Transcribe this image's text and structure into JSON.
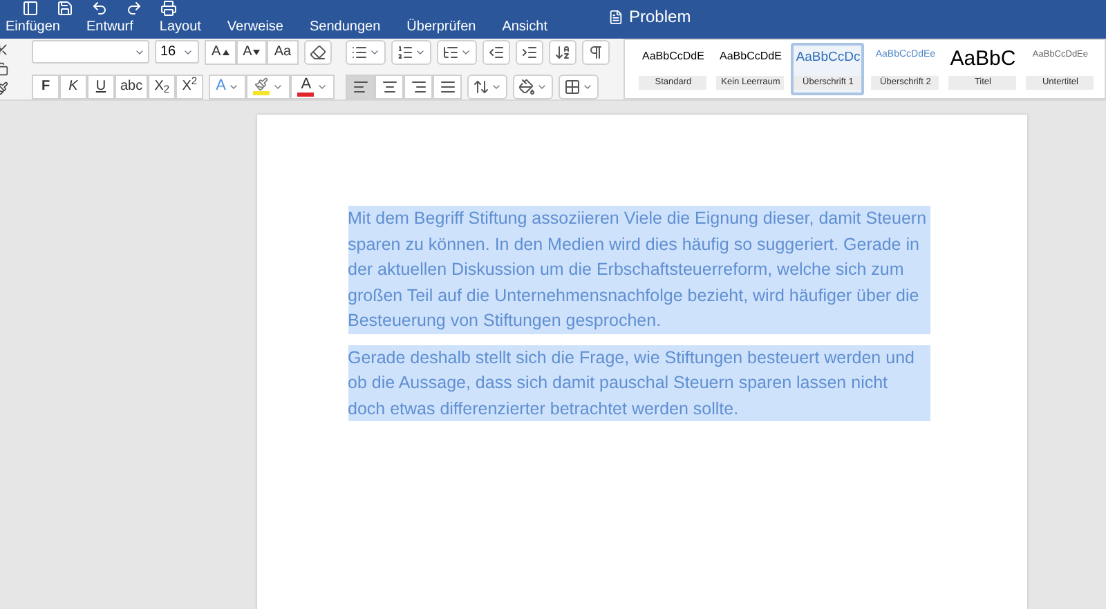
{
  "window": {
    "title": "Problem"
  },
  "tabs": [
    {
      "label": "Einfügen",
      "selected": false
    },
    {
      "label": "Entwurf",
      "selected": false
    },
    {
      "label": "Layout",
      "selected": false
    },
    {
      "label": "Verweise",
      "selected": false
    },
    {
      "label": "Sendungen",
      "selected": false
    },
    {
      "label": "Überprüfen",
      "selected": false
    },
    {
      "label": "Ansicht",
      "selected": false
    }
  ],
  "font": {
    "size": "16"
  },
  "format_buttons": [
    {
      "label": "F",
      "kind": "bold"
    },
    {
      "label": "K",
      "kind": "italic"
    },
    {
      "label": "U",
      "kind": "underline"
    },
    {
      "label": "abc",
      "kind": "strike"
    },
    {
      "label": "X$_{2}$",
      "kind": "script"
    },
    {
      "label": "X$^{2}$",
      "kind": "script"
    }
  ],
  "size_buttons": [
    {
      "label": "A",
      "kind": "grow"
    },
    {
      "label": "A",
      "kind": "shrink"
    },
    {
      "label": "Aa",
      "kind": "case"
    }
  ],
  "color_buttons": [
    {
      "label": "A",
      "kind": "effect",
      "color": "#4a90e2"
    },
    {
      "kind": "highlight",
      "color": "#f5e42a"
    },
    {
      "label": "A",
      "kind": "font",
      "color": "#e0262b"
    }
  ],
  "alignment": [
    {
      "kind": "left",
      "selected": true
    },
    {
      "kind": "center",
      "selected": false
    },
    {
      "kind": "right",
      "selected": false
    },
    {
      "kind": "justify",
      "selected": false
    }
  ],
  "styles": [
    {
      "preview": "AaBbCcDdE",
      "name": "Standard",
      "kind": "normal",
      "selected": false
    },
    {
      "preview": "AaBbCcDdE",
      "name": "Kein Leerraum",
      "kind": "normal",
      "selected": false
    },
    {
      "preview": "AaBbCcDc",
      "name": "Überschrift 1",
      "kind": "heading1",
      "selected": true
    },
    {
      "preview": "AaBbCcDdEe",
      "name": "Überschrift 2",
      "kind": "heading2",
      "selected": false
    },
    {
      "preview": "AaBbC",
      "name": "Titel",
      "kind": "title",
      "selected": false
    },
    {
      "preview": "AaBbCcDdEe",
      "name": "Untertitel",
      "kind": "subtitle",
      "selected": false
    }
  ],
  "document": {
    "paragraphs": [
      {
        "text": "Mit dem Begriff Stiftung assoziieren Viele die Eignung dieser, damit Steuern sparen zu können. In den Medien wird dies häufig so suggeriert. Gerade in der aktuellen Diskussion um die Erbschaftsteuerreform, welche sich zum großen Teil auf die Unternehmensnachfolge bezieht, wird häufiger über die Besteuerung von Stiftungen gesprochen.",
        "selected": true
      },
      {
        "text": "Gerade deshalb stellt sich die Frage, wie Stiftungen besteuert werden und ob die Aussage, dass sich damit pauschal Steuern sparen lassen nicht doch etwas differenzierter betrachtet werden sollte.",
        "selected": true
      }
    ]
  }
}
